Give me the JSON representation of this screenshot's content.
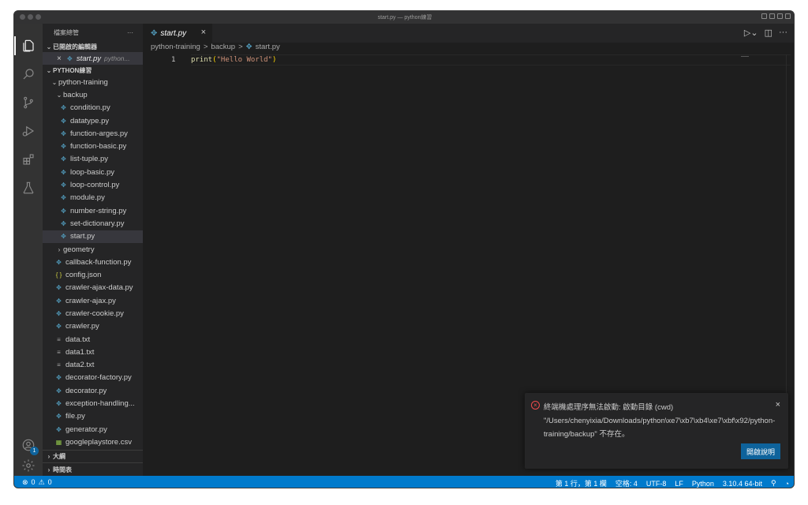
{
  "window": {
    "title": "start.py — python練習"
  },
  "activity_bar": {
    "items": [
      "files-icon",
      "search-icon",
      "source-control-icon",
      "run-debug-icon",
      "extensions-icon",
      "testing-icon"
    ],
    "accounts_badge": "1"
  },
  "sidebar": {
    "header": "檔案總管",
    "more": "···",
    "open_editors_label": "已開啟的編輯器",
    "open_editor": {
      "name": "start.py",
      "path": "python..."
    },
    "workspace_label": "PYTHON練習",
    "tree": [
      {
        "label": "python-training",
        "type": "folder-open",
        "depth": 1
      },
      {
        "label": "backup",
        "type": "folder-open",
        "depth": 2
      },
      {
        "label": "condition.py",
        "type": "py",
        "depth": 3
      },
      {
        "label": "datatype.py",
        "type": "py",
        "depth": 3
      },
      {
        "label": "function-arges.py",
        "type": "py",
        "depth": 3
      },
      {
        "label": "function-basic.py",
        "type": "py",
        "depth": 3
      },
      {
        "label": "list-tuple.py",
        "type": "py",
        "depth": 3
      },
      {
        "label": "loop-basic.py",
        "type": "py",
        "depth": 3
      },
      {
        "label": "loop-control.py",
        "type": "py",
        "depth": 3
      },
      {
        "label": "module.py",
        "type": "py",
        "depth": 3
      },
      {
        "label": "number-string.py",
        "type": "py",
        "depth": 3
      },
      {
        "label": "set-dictionary.py",
        "type": "py",
        "depth": 3
      },
      {
        "label": "start.py",
        "type": "py",
        "depth": 3,
        "selected": true
      },
      {
        "label": "geometry",
        "type": "folder",
        "depth": 2
      },
      {
        "label": "callback-function.py",
        "type": "py",
        "depth": 2
      },
      {
        "label": "config.json",
        "type": "json",
        "depth": 2
      },
      {
        "label": "crawler-ajax-data.py",
        "type": "py",
        "depth": 2
      },
      {
        "label": "crawler-ajax.py",
        "type": "py",
        "depth": 2
      },
      {
        "label": "crawler-cookie.py",
        "type": "py",
        "depth": 2
      },
      {
        "label": "crawler.py",
        "type": "py",
        "depth": 2
      },
      {
        "label": "data.txt",
        "type": "txt",
        "depth": 2
      },
      {
        "label": "data1.txt",
        "type": "txt",
        "depth": 2
      },
      {
        "label": "data2.txt",
        "type": "txt",
        "depth": 2
      },
      {
        "label": "decorator-factory.py",
        "type": "py",
        "depth": 2
      },
      {
        "label": "decorator.py",
        "type": "py",
        "depth": 2
      },
      {
        "label": "exception-handling...",
        "type": "py",
        "depth": 2
      },
      {
        "label": "file.py",
        "type": "py",
        "depth": 2
      },
      {
        "label": "generator.py",
        "type": "py",
        "depth": 2
      },
      {
        "label": "googleplaystore.csv",
        "type": "csv",
        "depth": 2
      }
    ],
    "outline_label": "大綱",
    "timeline_label": "時間表"
  },
  "tab": {
    "label": "start.py",
    "close": "×"
  },
  "breadcrumb": {
    "part1": "python-training",
    "part2": "backup",
    "part3": "start.py",
    "sep": ">"
  },
  "editor": {
    "line_number": "1",
    "code_fn": "print",
    "code_open": "(",
    "code_str": "\"Hello World\"",
    "code_close": ")"
  },
  "notification": {
    "message": "終端機處理序無法啟動: 啟動目錄 (cwd) \"/Users/chenyixia/Downloads/python\\xe7\\xb7\\xb4\\xe7\\xbf\\x92/python-training/backup\" 不存在。",
    "button": "開啟說明",
    "close": "×",
    "icon": "error-icon"
  },
  "statusbar": {
    "errors": "0",
    "warnings": "0",
    "position": "第 1 行，第 1 欄",
    "spaces": "空格: 4",
    "encoding": "UTF-8",
    "eol": "LF",
    "language": "Python",
    "interpreter": "3.10.4 64-bit"
  },
  "colors": {
    "accent": "#007acc",
    "button": "#0e639c",
    "error": "#f14c4c",
    "editor_bg": "#1e1e1e",
    "sidebar_bg": "#252526"
  }
}
